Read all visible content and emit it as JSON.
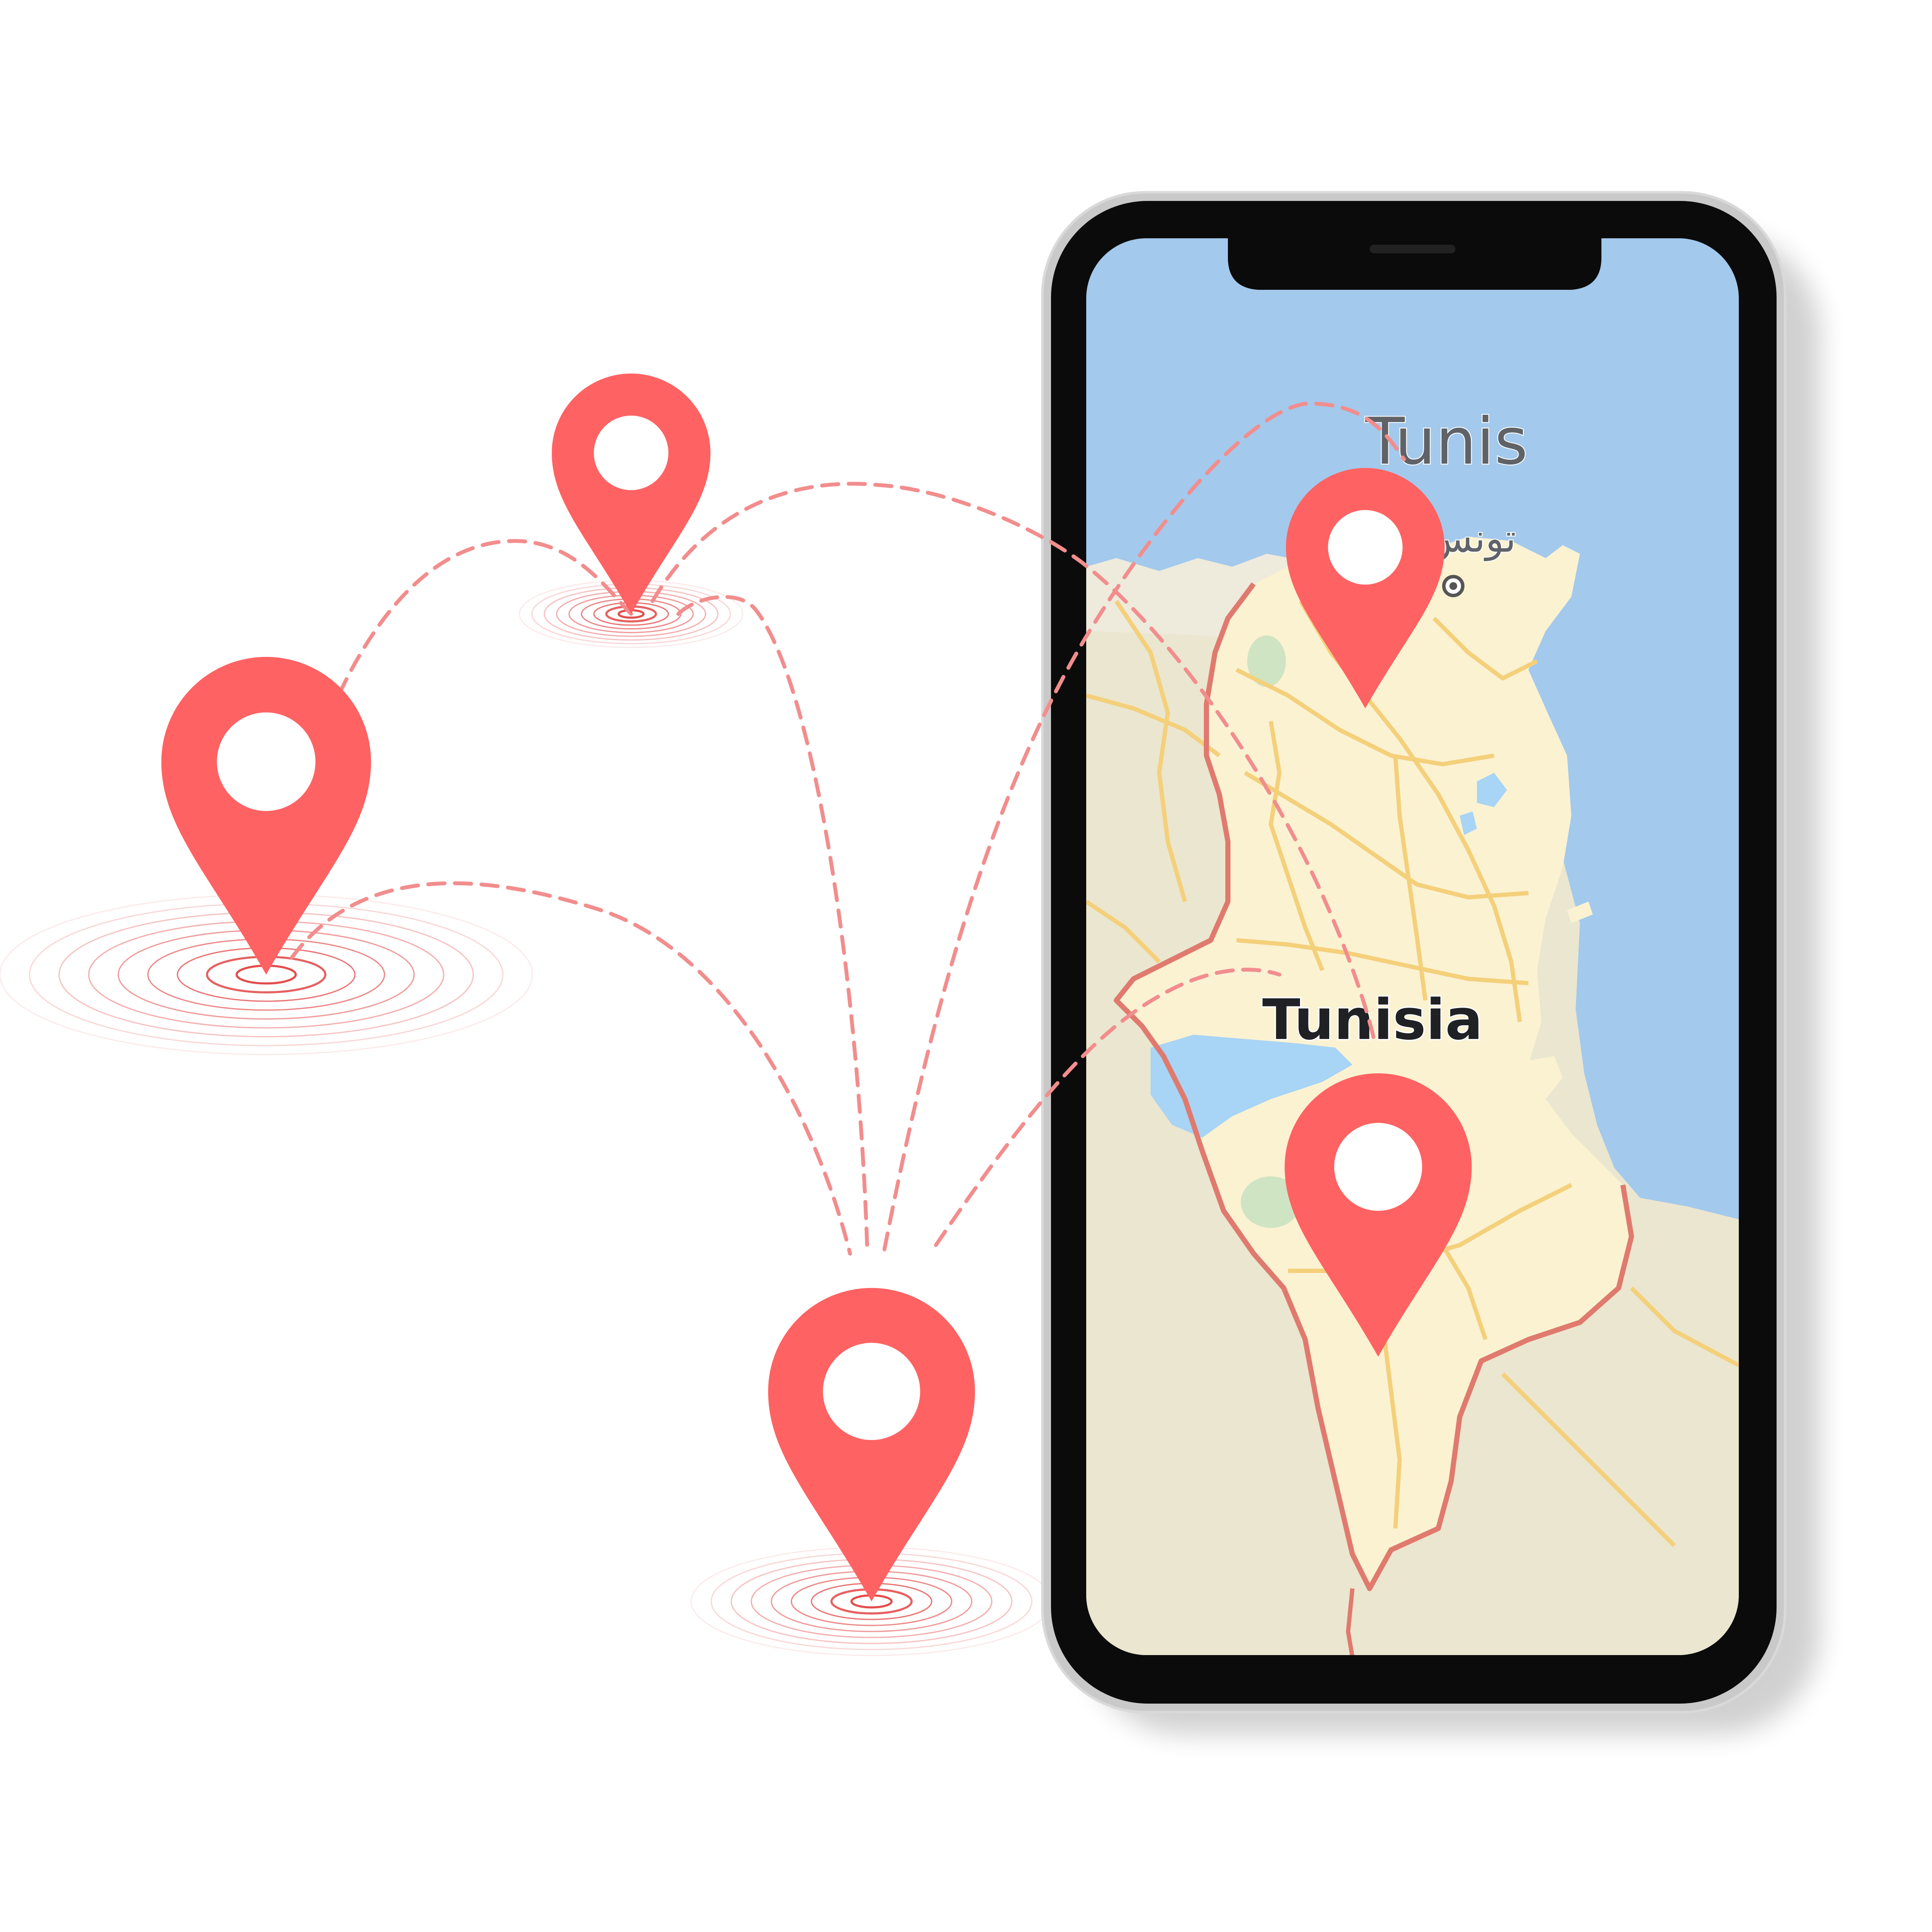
{
  "map": {
    "city_label": "Tunis",
    "city_label_arabic": "تونس",
    "country_label": "Tunisia",
    "colors": {
      "sea": "#a3c9ec",
      "land_outside": "#ebe6cf",
      "land_inside": "#fbf2d2",
      "land_north": "#eeeadc",
      "border": "#e07a6e",
      "roads": "#f4d07b",
      "lake": "#a8d4f5",
      "park": "#cfe4c2"
    }
  },
  "pins": {
    "color": "#ff6262",
    "hole_color": "#ffffff",
    "ring_color": "#e03a3a",
    "route_color": "#f28d8d"
  },
  "phone": {
    "frame_color": "#0b0b0b",
    "bezel_color": "#c9c9c9",
    "speaker_color": "#222222"
  }
}
